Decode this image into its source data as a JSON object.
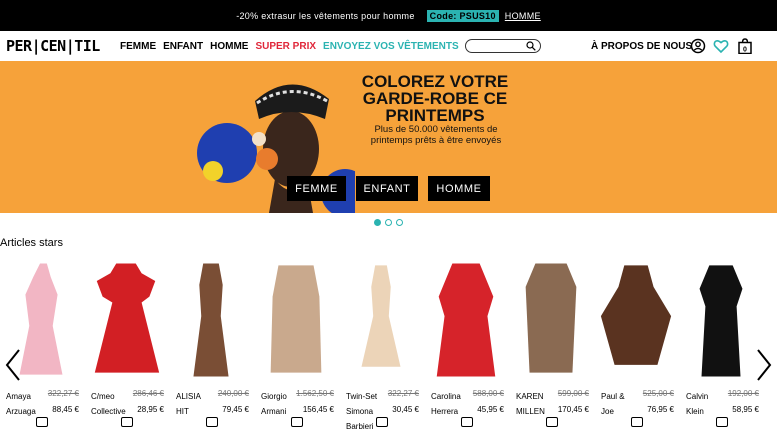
{
  "topbar": {
    "text": "-20% extrasur les vêtements pour homme",
    "code": "Code: PSUS10",
    "link": "HOMME"
  },
  "nav": {
    "logo": "PER|CEN|TIL",
    "menu": [
      {
        "label": "FEMME",
        "color": "#000000"
      },
      {
        "label": "ENFANT",
        "color": "#000000"
      },
      {
        "label": "HOMME",
        "color": "#000000"
      },
      {
        "label": "SUPER PRIX",
        "color": "#e0273a"
      },
      {
        "label": "ENVOYEZ VOS VÊTEMENTS",
        "color": "#2bb3b1"
      }
    ],
    "search_placeholder": "",
    "about": "À PROPOS DE NOUS",
    "cart_count": "0",
    "icons": [
      "account-icon",
      "heart-icon",
      "cart-icon"
    ]
  },
  "hero": {
    "title": "COLOREZ VOTRE GARDE-ROBE CE PRINTEMPS",
    "subtitle": "Plus de 50.000 vêtements de printemps prêts à être envoyés",
    "buttons": [
      "FEMME",
      "ENFANT",
      "HOMME"
    ],
    "background": "#f6a23a",
    "slides": 3,
    "active_slide": 1
  },
  "section": {
    "title": "Articles stars"
  },
  "products": [
    {
      "brand": "Amaya Arzuaga",
      "old_price": "322,27 €",
      "price": "88,45 €",
      "color": "#f2b6c4"
    },
    {
      "brand": "C/meo Collective",
      "old_price": "286,46 €",
      "price": "28,95 €",
      "color": "#d21f24"
    },
    {
      "brand": "ALISIA HIT",
      "old_price": "240,00 €",
      "price": "79,45 €",
      "color": "#7a4e35"
    },
    {
      "brand": "Giorgio Armani",
      "old_price": "1.562,50 €",
      "price": "156,45 €",
      "color": "#c9a98d"
    },
    {
      "brand": "Twin-Set Simona Barbieri",
      "old_price": "322,27 €",
      "price": "30,45 €",
      "color": "#ecd4b8"
    },
    {
      "brand": "Carolina Herrera",
      "old_price": "588,00 €",
      "price": "45,95 €",
      "color": "#d6232a"
    },
    {
      "brand": "KAREN MILLEN",
      "old_price": "599,00 €",
      "price": "170,45 €",
      "color": "#8a6a52"
    },
    {
      "brand": "Paul & Joe",
      "old_price": "525,00 €",
      "price": "76,95 €",
      "color": "#5a3320"
    },
    {
      "brand": "Calvin Klein",
      "old_price": "192,00 €",
      "price": "58,95 €",
      "color": "#111111"
    }
  ]
}
